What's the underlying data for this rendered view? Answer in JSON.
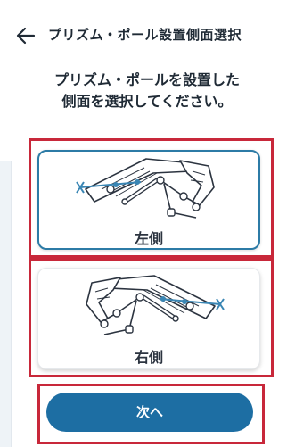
{
  "header": {
    "title": "プリズム・ポール設置側面選択",
    "back_icon": "arrow-left-icon"
  },
  "instruction": {
    "line1": "プリズム・ポールを設置した",
    "line2": "側面を選択してください。"
  },
  "options": [
    {
      "label": "左側",
      "selected": true
    },
    {
      "label": "右側",
      "selected": false
    }
  ],
  "next_button": {
    "label": "次へ"
  },
  "colors": {
    "accent": "#1d6ea3",
    "selected_border": "#2c7ba6",
    "highlight": "#c8283a",
    "prism": "#3a86b4"
  }
}
